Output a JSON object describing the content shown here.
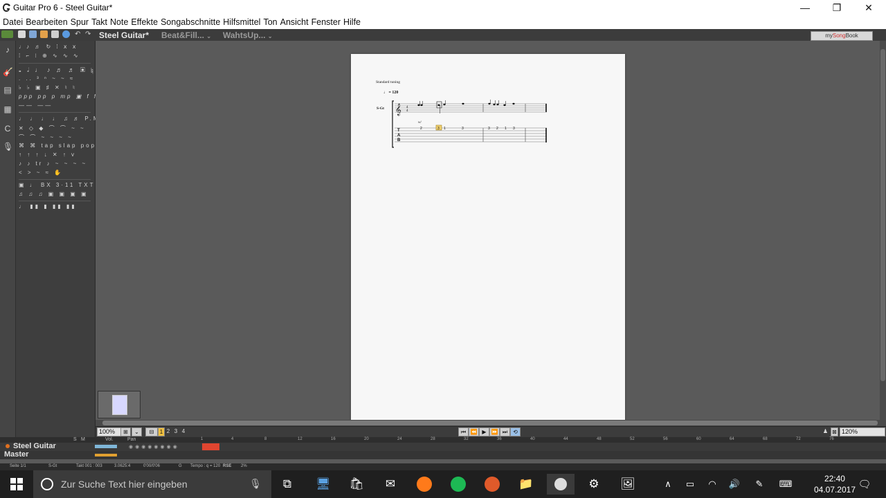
{
  "window": {
    "title": "Guitar Pro 6 - Steel Guitar*",
    "minimize_glyph": "—",
    "maximize_glyph": "❐",
    "close_glyph": "✕"
  },
  "menu": [
    "Datei",
    "Bearbeiten",
    "Spur",
    "Takt",
    "Note",
    "Effekte",
    "Songabschnitte",
    "Hilfsmittel",
    "Ton",
    "Ansicht",
    "Fenster",
    "Hilfe"
  ],
  "tabs": [
    {
      "label": "Steel Guitar*",
      "active": true
    },
    {
      "label": "Beat&Fill...",
      "active": false
    },
    {
      "label": "WahtsUp...",
      "active": false
    }
  ],
  "mysongbook": {
    "prefix": "my",
    "accent": "Song",
    "suffix": "Book"
  },
  "score": {
    "tuning": "Standard tuning",
    "tempo": "♩ = 120",
    "track_short": "S-Gt",
    "tab_letters": [
      "T",
      "A",
      "B"
    ],
    "tab_numbers": [
      "2",
      "3",
      "1",
      "3",
      "3",
      "2",
      "1",
      "3"
    ],
    "harmonic_label": "w/"
  },
  "transport": {
    "zoom": "100%",
    "zoom_right": "120%",
    "beat_markers": [
      "1",
      "2",
      "3",
      "4"
    ]
  },
  "tracks": {
    "header_solo": "S",
    "header_mute": "M",
    "vol_label": "Vol.",
    "pan_label": "Pan",
    "items": [
      {
        "name": "Steel Guitar"
      },
      {
        "name": "Master"
      }
    ]
  },
  "timeline_ticks": [
    "1",
    "4",
    "8",
    "12",
    "16",
    "20",
    "24",
    "28",
    "32",
    "36",
    "40",
    "44",
    "48",
    "52",
    "56",
    "60",
    "64",
    "68",
    "72",
    "76"
  ],
  "statusbar": {
    "page": "Seite 1/1",
    "track": "S-Gt",
    "bar": "Takt 001 : 003",
    "position": "3.0625:4",
    "time": "0'00/0'06",
    "key": "G",
    "tempo": "Tempo : q = 120",
    "rse": "RSE",
    "percent": "2%"
  },
  "taskbar": {
    "search_placeholder": "Zur Suche Text hier eingeben",
    "time": "22:40",
    "date": "04.07.2017"
  },
  "colors": {
    "accent_orange": "#e07020",
    "spotify_green": "#1db954",
    "firefox_orange": "#ff7a1a"
  }
}
